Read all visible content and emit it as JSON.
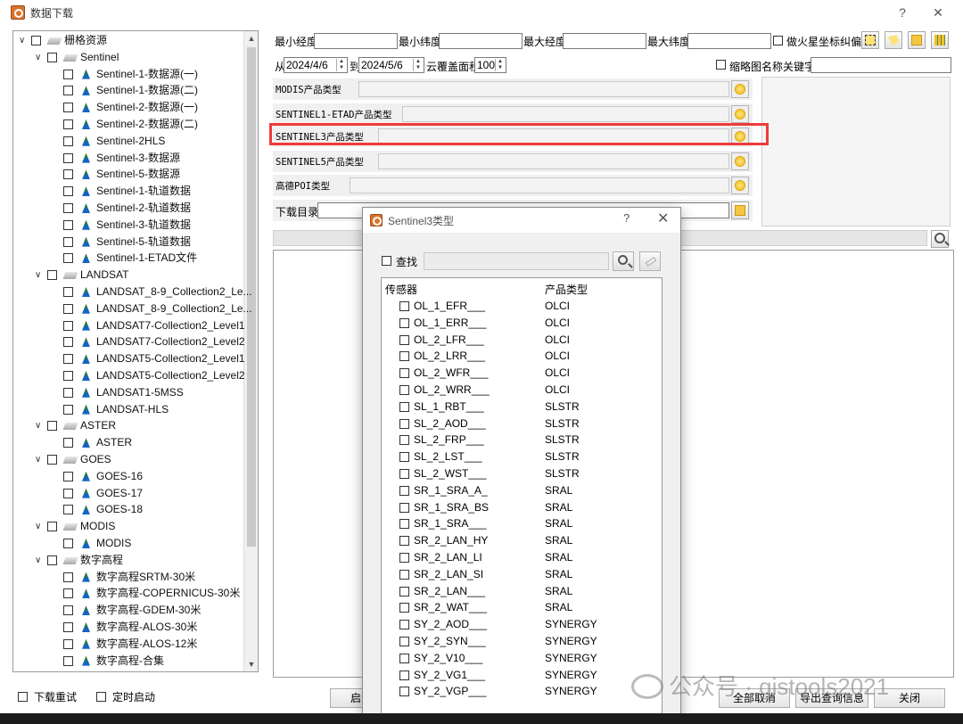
{
  "window": {
    "title": "数据下载",
    "help": "?",
    "close": "✕"
  },
  "tree": {
    "items": [
      {
        "level": 0,
        "label": "栅格资源",
        "kind": "folder",
        "chevron": "∨"
      },
      {
        "level": 1,
        "label": "Sentinel",
        "kind": "folder",
        "chevron": "∨"
      },
      {
        "level": 2,
        "label": "Sentinel-1-数据源(一)",
        "kind": "leaf"
      },
      {
        "level": 2,
        "label": "Sentinel-1-数据源(二)",
        "kind": "leaf"
      },
      {
        "level": 2,
        "label": "Sentinel-2-数据源(一)",
        "kind": "leaf"
      },
      {
        "level": 2,
        "label": "Sentinel-2-数据源(二)",
        "kind": "leaf"
      },
      {
        "level": 2,
        "label": "Sentinel-2HLS",
        "kind": "leaf"
      },
      {
        "level": 2,
        "label": "Sentinel-3-数据源",
        "kind": "leaf"
      },
      {
        "level": 2,
        "label": "Sentinel-5-数据源",
        "kind": "leaf"
      },
      {
        "level": 2,
        "label": "Sentinel-1-轨道数据",
        "kind": "leaf"
      },
      {
        "level": 2,
        "label": "Sentinel-2-轨道数据",
        "kind": "leaf"
      },
      {
        "level": 2,
        "label": "Sentinel-3-轨道数据",
        "kind": "leaf"
      },
      {
        "level": 2,
        "label": "Sentinel-5-轨道数据",
        "kind": "leaf"
      },
      {
        "level": 2,
        "label": "Sentinel-1-ETAD文件",
        "kind": "leaf"
      },
      {
        "level": 1,
        "label": "LANDSAT",
        "kind": "folder",
        "chevron": "∨"
      },
      {
        "level": 2,
        "label": "LANDSAT_8-9_Collection2_Le...",
        "kind": "leaf"
      },
      {
        "level": 2,
        "label": "LANDSAT_8-9_Collection2_Le...",
        "kind": "leaf"
      },
      {
        "level": 2,
        "label": "LANDSAT7-Collection2_Level1",
        "kind": "leaf"
      },
      {
        "level": 2,
        "label": "LANDSAT7-Collection2_Level2",
        "kind": "leaf"
      },
      {
        "level": 2,
        "label": "LANDSAT5-Collection2_Level1",
        "kind": "leaf"
      },
      {
        "level": 2,
        "label": "LANDSAT5-Collection2_Level2",
        "kind": "leaf"
      },
      {
        "level": 2,
        "label": "LANDSAT1-5MSS",
        "kind": "leaf"
      },
      {
        "level": 2,
        "label": "LANDSAT-HLS",
        "kind": "leaf"
      },
      {
        "level": 1,
        "label": "ASTER",
        "kind": "folder",
        "chevron": "∨"
      },
      {
        "level": 2,
        "label": "ASTER",
        "kind": "leaf"
      },
      {
        "level": 1,
        "label": "GOES",
        "kind": "folder",
        "chevron": "∨"
      },
      {
        "level": 2,
        "label": "GOES-16",
        "kind": "leaf"
      },
      {
        "level": 2,
        "label": "GOES-17",
        "kind": "leaf"
      },
      {
        "level": 2,
        "label": "GOES-18",
        "kind": "leaf"
      },
      {
        "level": 1,
        "label": "MODIS",
        "kind": "folder",
        "chevron": "∨"
      },
      {
        "level": 2,
        "label": "MODIS",
        "kind": "leaf"
      },
      {
        "level": 1,
        "label": "数字高程",
        "kind": "folder",
        "chevron": "∨"
      },
      {
        "level": 2,
        "label": "数字高程SRTM-30米",
        "kind": "leaf"
      },
      {
        "level": 2,
        "label": "数字高程-COPERNICUS-30米",
        "kind": "leaf"
      },
      {
        "level": 2,
        "label": "数字高程-GDEM-30米",
        "kind": "leaf"
      },
      {
        "level": 2,
        "label": "数字高程-ALOS-30米",
        "kind": "leaf"
      },
      {
        "level": 2,
        "label": "数字高程-ALOS-12米",
        "kind": "leaf"
      },
      {
        "level": 2,
        "label": "数字高程-合集",
        "kind": "leaf"
      }
    ]
  },
  "bottom_options": {
    "redownload": "下载重试",
    "timed_start": "定时启动"
  },
  "bounds": {
    "min_lon": "最小经度",
    "min_lat": "最小纬度",
    "max_lon": "最大经度",
    "max_lat": "最大纬度",
    "mars_coord": "做火星坐标纠偏"
  },
  "date": {
    "from_label": "从",
    "from": "2024/4/6",
    "to_label": "到",
    "to": "2024/5/6",
    "cloud_label": "云覆盖面积",
    "cloud": "100"
  },
  "thumbnail_label": "缩略图",
  "keyword_label": "名称关键字",
  "product_types": [
    {
      "label": "MODIS产品类型"
    },
    {
      "label": "SENTINEL1-ETAD产品类型"
    },
    {
      "label": "SENTINEL3产品类型"
    },
    {
      "label": "SENTINEL5产品类型"
    },
    {
      "label": "高德POI类型"
    }
  ],
  "download_dir_label": "下载目录",
  "bottom_buttons": {
    "start": "启动",
    "cancel_all": "全部取消",
    "export": "导出查询信息",
    "close": "关闭"
  },
  "dialog": {
    "title": "Sentinel3类型",
    "help": "?",
    "close": "✕",
    "search_label": "查找",
    "col_sensor": "传感器",
    "col_product": "产品类型",
    "rows": [
      {
        "sensor": "OL_1_EFR___",
        "product": "OLCI"
      },
      {
        "sensor": "OL_1_ERR___",
        "product": "OLCI"
      },
      {
        "sensor": "OL_2_LFR___",
        "product": "OLCI"
      },
      {
        "sensor": "OL_2_LRR___",
        "product": "OLCI"
      },
      {
        "sensor": "OL_2_WFR___",
        "product": "OLCI"
      },
      {
        "sensor": "OL_2_WRR___",
        "product": "OLCI"
      },
      {
        "sensor": "SL_1_RBT___",
        "product": "SLSTR"
      },
      {
        "sensor": "SL_2_AOD___",
        "product": "SLSTR"
      },
      {
        "sensor": "SL_2_FRP___",
        "product": "SLSTR"
      },
      {
        "sensor": "SL_2_LST___",
        "product": "SLSTR"
      },
      {
        "sensor": "SL_2_WST___",
        "product": "SLSTR"
      },
      {
        "sensor": "SR_1_SRA_A_",
        "product": "SRAL"
      },
      {
        "sensor": "SR_1_SRA_BS",
        "product": "SRAL"
      },
      {
        "sensor": "SR_1_SRA___",
        "product": "SRAL"
      },
      {
        "sensor": "SR_2_LAN_HY",
        "product": "SRAL"
      },
      {
        "sensor": "SR_2_LAN_LI",
        "product": "SRAL"
      },
      {
        "sensor": "SR_2_LAN_SI",
        "product": "SRAL"
      },
      {
        "sensor": "SR_2_LAN___",
        "product": "SRAL"
      },
      {
        "sensor": "SR_2_WAT___",
        "product": "SRAL"
      },
      {
        "sensor": "SY_2_AOD___",
        "product": "SYNERGY"
      },
      {
        "sensor": "SY_2_SYN___",
        "product": "SYNERGY"
      },
      {
        "sensor": "SY_2_V10___",
        "product": "SYNERGY"
      },
      {
        "sensor": "SY_2_VG1___",
        "product": "SYNERGY"
      },
      {
        "sensor": "SY_2_VGP___",
        "product": "SYNERGY"
      }
    ]
  },
  "watermark": "公众号 · gistools2021",
  "colors": {
    "highlight": "#ef3b3b",
    "accent": "#d9742a"
  }
}
